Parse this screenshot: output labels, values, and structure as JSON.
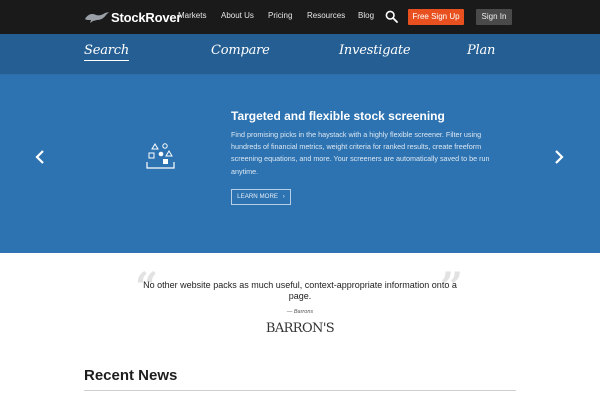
{
  "header": {
    "logo_text": "StockRover",
    "nav": [
      "Markets",
      "About Us",
      "Pricing",
      "Resources",
      "Blog"
    ],
    "signup_label": "Free Sign Up",
    "signin_label": "Sign In"
  },
  "tabs": [
    {
      "label": "Search",
      "active": true
    },
    {
      "label": "Compare",
      "active": false
    },
    {
      "label": "Investigate",
      "active": false
    },
    {
      "label": "Plan",
      "active": false
    }
  ],
  "hero": {
    "title": "Targeted and flexible stock screening",
    "description": "Find promising picks in the haystack with a highly flexible screener. Filter using hundreds of financial metrics, weight criteria for ranked results, create freeform screening equations, and more. Your screeners are automatically saved to be run anytime.",
    "cta_label": "LEARN MORE",
    "cta_arrow": "›"
  },
  "quote": {
    "open_mark": "“",
    "close_mark": "”",
    "text": "No other website packs as much useful, context-appropriate information onto a page.",
    "source": "— Barrons",
    "logo_text": "BARRON'S"
  },
  "news": {
    "heading": "Recent News"
  },
  "colors": {
    "topbar": "#1a1a1a",
    "tabbar": "#245e92",
    "hero": "#2d73b1",
    "signup": "#e8511f",
    "signin": "#4a4a4a"
  },
  "icons": [
    "stockrover-bull-icon",
    "search-icon",
    "chevron-left-icon",
    "chevron-right-icon",
    "screening-shapes-icon"
  ]
}
